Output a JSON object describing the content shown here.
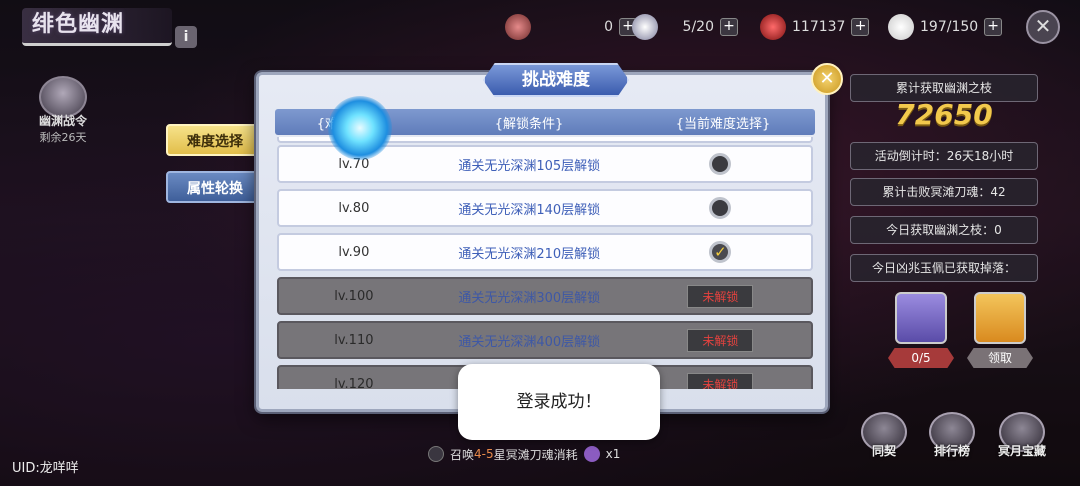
{
  "header": {
    "title": "绯色幽渊",
    "info_label": "i"
  },
  "battlepass": {
    "name": "幽渊战令",
    "remaining": "剩余26天"
  },
  "resources": [
    {
      "icon": "gem-icon",
      "value": "0"
    },
    {
      "icon": "eye-orb-icon",
      "value": "5/20"
    },
    {
      "icon": "red-blade-icon",
      "value": "117137"
    },
    {
      "icon": "feather-icon",
      "value": "197/150"
    }
  ],
  "plus_label": "+",
  "close_label": "✕",
  "tabs": [
    {
      "label": "难度选择",
      "active": true
    },
    {
      "label": "属性轮换",
      "active": false
    }
  ],
  "modal": {
    "title": "挑战难度",
    "close_label": "✕",
    "headers": [
      "{",
      "{解锁条件}",
      "{当前难度选择}"
    ],
    "header_level": "{难度等级}",
    "rows": [
      {
        "level": "lv.70",
        "condition": "通关无光深渊105层解锁",
        "state": "unchecked"
      },
      {
        "level": "lv.80",
        "condition": "通关无光深渊140层解锁",
        "state": "unchecked"
      },
      {
        "level": "lv.90",
        "condition": "通关无光深渊210层解锁",
        "state": "checked"
      },
      {
        "level": "lv.100",
        "condition": "通关无光深渊300层解锁",
        "state": "locked"
      },
      {
        "level": "lv.110",
        "condition": "通关无光深渊400层解锁",
        "state": "locked"
      },
      {
        "level": "lv.120",
        "condition": "",
        "state": "locked"
      }
    ],
    "locked_label": "未解锁",
    "check_mark": "✓"
  },
  "right_panel": {
    "total_label": "累计获取幽渊之枝",
    "total_value": "72650",
    "countdown": "活动倒计时：26天18小时",
    "defeated": "累计击败冥滩刀魂：42",
    "today": "今日获取幽渊之枝：0",
    "drop": "今日凶兆玉佩已获取掉落：",
    "reward_tags": [
      "0/5",
      "领取"
    ]
  },
  "bottom_buttons": [
    "同契",
    "排行榜",
    "冥月宝藏"
  ],
  "summon": {
    "prefix": "召唤",
    "highlight": "4-5",
    "suffix": "星冥滩刀魂消耗",
    "cost": "x1"
  },
  "uid": "UID:龙咩咩",
  "toast": "登录成功！",
  "colors": {
    "accent_gold": "#f2c94c",
    "tab_active": "#e2be4a",
    "tab_inactive": "#3f5f9a",
    "locked_text": "#e3423f"
  }
}
